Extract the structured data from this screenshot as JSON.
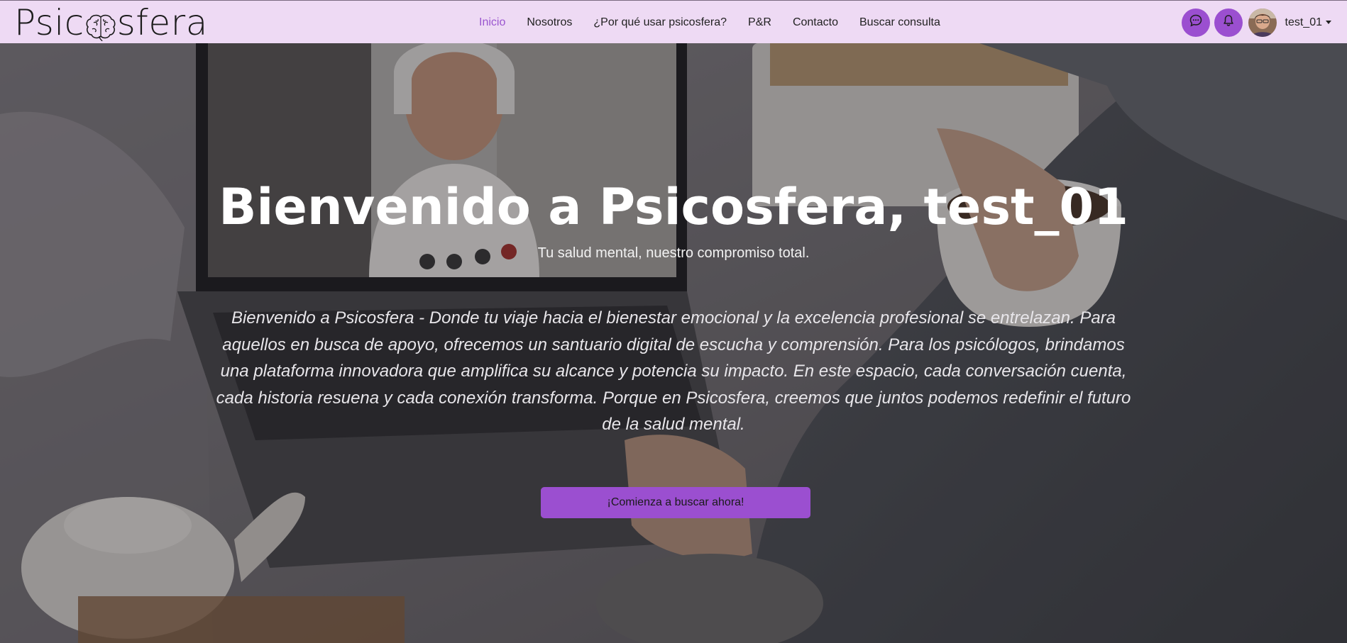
{
  "brand": {
    "name_left": "Psic",
    "name_right": "sfera"
  },
  "nav": {
    "items": [
      {
        "label": "Inicio",
        "active": true
      },
      {
        "label": "Nosotros",
        "active": false
      },
      {
        "label": "¿Por qué usar psicosfera?",
        "active": false
      },
      {
        "label": "P&R",
        "active": false
      },
      {
        "label": "Contacto",
        "active": false
      },
      {
        "label": "Buscar consulta",
        "active": false
      }
    ],
    "icons": {
      "messages": "chat-bubble-icon",
      "notifications": "bell-icon"
    },
    "user": {
      "name": "test_01"
    }
  },
  "hero": {
    "title": "Bienvenido a Psicosfera, test_01",
    "subtitle": "Tu salud mental, nuestro compromiso total.",
    "body": "Bienvenido a Psicosfera - Donde tu viaje hacia el bienestar emocional y la excelencia profesional se entrelazan. Para aquellos en busca de apoyo, ofrecemos un santuario digital de escucha y comprensión. Para los psicólogos, brindamos una plataforma innovadora que amplifica su alcance y potencia su impacto. En este espacio, cada conversación cuenta, cada historia resuena y cada conexión transforma. Porque en Psicosfera, creemos que juntos podemos redefinir el futuro de la salud mental.",
    "cta_label": "¡Comienza a buscar ahora!"
  },
  "colors": {
    "navbar_bg": "#eedaf4",
    "accent": "#9b4fd0",
    "active_link": "#9a55cf"
  }
}
